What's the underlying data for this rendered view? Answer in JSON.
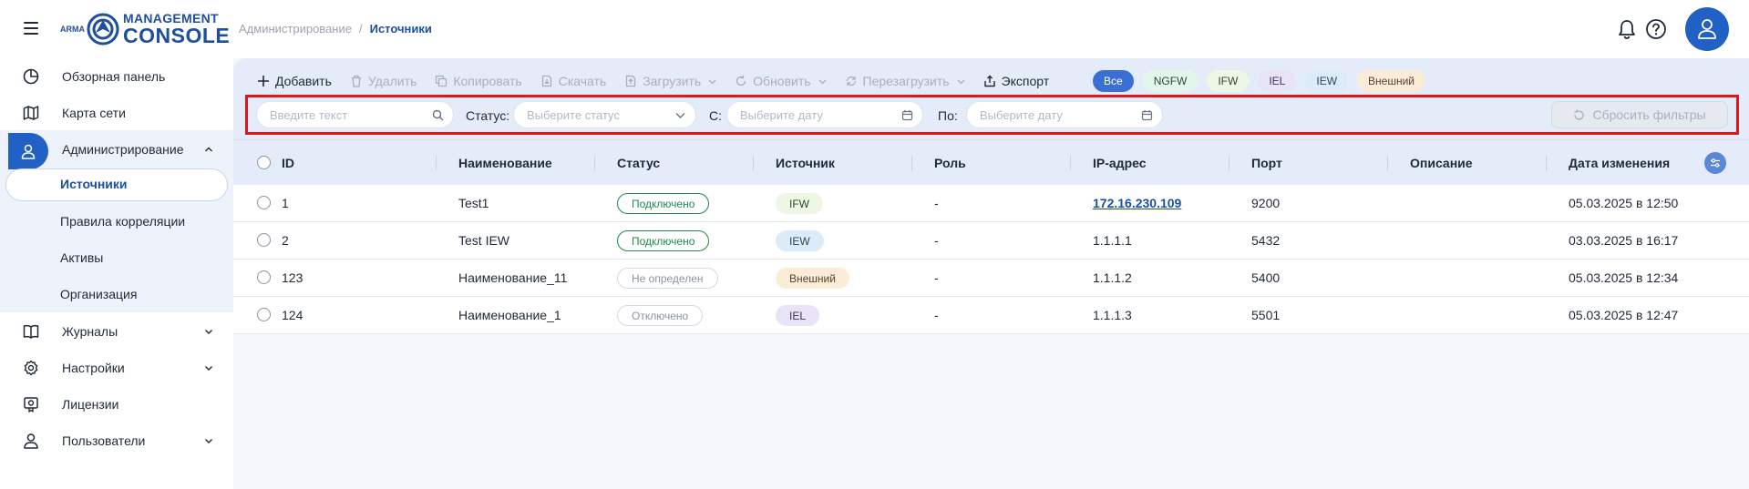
{
  "header": {
    "logo": {
      "arma": "ARMA",
      "line1": "MANAGEMENT",
      "line2": "CONSOLE"
    },
    "breadcrumb": {
      "parent": "Администрирование",
      "separator": "/",
      "current": "Источники"
    }
  },
  "sidebar": {
    "items": [
      {
        "label": "Обзорная панель",
        "icon": "dashboard-icon"
      },
      {
        "label": "Карта сети",
        "icon": "map-icon"
      },
      {
        "label": "Администрирование",
        "icon": "user-icon",
        "expanded": true
      },
      {
        "label": "Журналы",
        "icon": "book-icon"
      },
      {
        "label": "Настройки",
        "icon": "gear-icon"
      },
      {
        "label": "Лицензии",
        "icon": "license-icon"
      },
      {
        "label": "Пользователи",
        "icon": "users-icon"
      }
    ],
    "sub_items": [
      "Источники",
      "Правила корреляции",
      "Активы",
      "Организация"
    ]
  },
  "toolbar": {
    "add": "Добавить",
    "delete": "Удалить",
    "copy": "Копировать",
    "download": "Скачать",
    "upload": "Загрузить",
    "refresh": "Обновить",
    "reload": "Перезагрузить",
    "export": "Экспорт"
  },
  "chips": [
    {
      "label": "Все",
      "bg": "#3b6fd3",
      "fg": "#ffffff",
      "selected": true
    },
    {
      "label": "NGFW",
      "bg": "#e3f6ea",
      "fg": "#2e4a36"
    },
    {
      "label": "IFW",
      "bg": "#eef7e6",
      "fg": "#33452a"
    },
    {
      "label": "IEL",
      "bg": "#e8e3f7",
      "fg": "#3c3460"
    },
    {
      "label": "IEW",
      "bg": "#dcebf8",
      "fg": "#2b4560"
    },
    {
      "label": "Внешний",
      "bg": "#fbecd8",
      "fg": "#5a4327"
    }
  ],
  "filters": {
    "search_placeholder": "Введите текст",
    "status_label": "Статус:",
    "status_placeholder": "Выберите статус",
    "from_label": "С:",
    "from_placeholder": "Выберите дату",
    "to_label": "По:",
    "to_placeholder": "Выберите дату",
    "reset": "Сбросить фильтры"
  },
  "table": {
    "columns": [
      "ID",
      "Наименование",
      "Статус",
      "Источник",
      "Роль",
      "IP-адрес",
      "Порт",
      "Описание",
      "Дата изменения"
    ],
    "rows": [
      {
        "id": "1",
        "name": "Test1",
        "status": "Подключено",
        "source": "IFW",
        "role": "-",
        "ip": "172.16.230.109",
        "port": "9200",
        "description": "",
        "date": "05.03.2025 в 12:50"
      },
      {
        "id": "2",
        "name": "Test IEW",
        "status": "Подключено",
        "source": "IEW",
        "role": "-",
        "ip": "1.1.1.1",
        "port": "5432",
        "description": "",
        "date": "03.03.2025 в 16:17"
      },
      {
        "id": "123",
        "name": "Наименование_11",
        "status": "Не определен",
        "source": "Внешний",
        "role": "-",
        "ip": "1.1.1.2",
        "port": "5400",
        "description": "",
        "date": "05.03.2025 в 12:34"
      },
      {
        "id": "124",
        "name": "Наименование_1",
        "status": "Отключено",
        "source": "IEL",
        "role": "-",
        "ip": "1.1.1.3",
        "port": "5501",
        "description": "",
        "date": "05.03.2025 в 12:47"
      }
    ]
  },
  "colors": {
    "primary": "#2160c4",
    "status_connected": "#1f8a4c",
    "status_neutral": "#8a94a3",
    "highlight_border": "#e0161d"
  }
}
